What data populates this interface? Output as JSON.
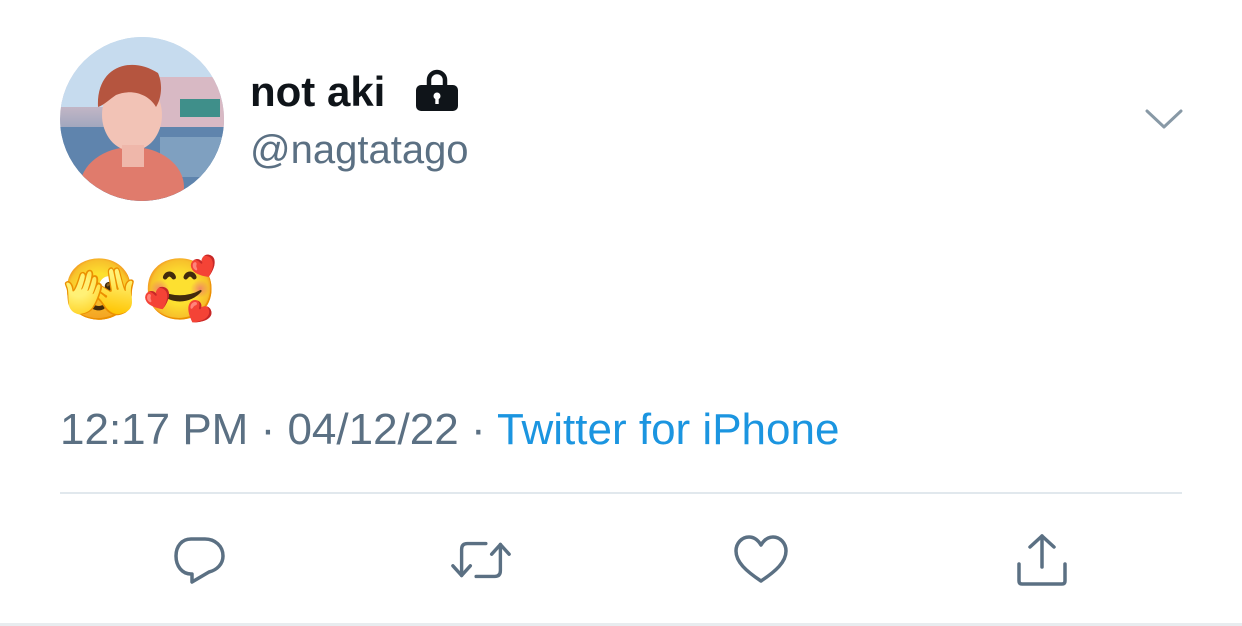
{
  "tweet": {
    "display_name": "not aki",
    "handle": "@nagtatago",
    "text": "🫣🥰",
    "time": "12:17 PM",
    "separator": " · ",
    "date": "04/12/22",
    "source": "Twitter for iPhone"
  },
  "icons": {
    "lock": "lock-icon",
    "more": "chevron-down-icon",
    "reply": "reply-icon",
    "retweet": "retweet-icon",
    "like": "heart-icon",
    "share": "share-icon"
  },
  "colors": {
    "primary_text": "#0f1419",
    "secondary_text": "#5b7083",
    "link": "#1b95e0",
    "icon": "#5b7083",
    "divider": "#e1e8ed"
  }
}
